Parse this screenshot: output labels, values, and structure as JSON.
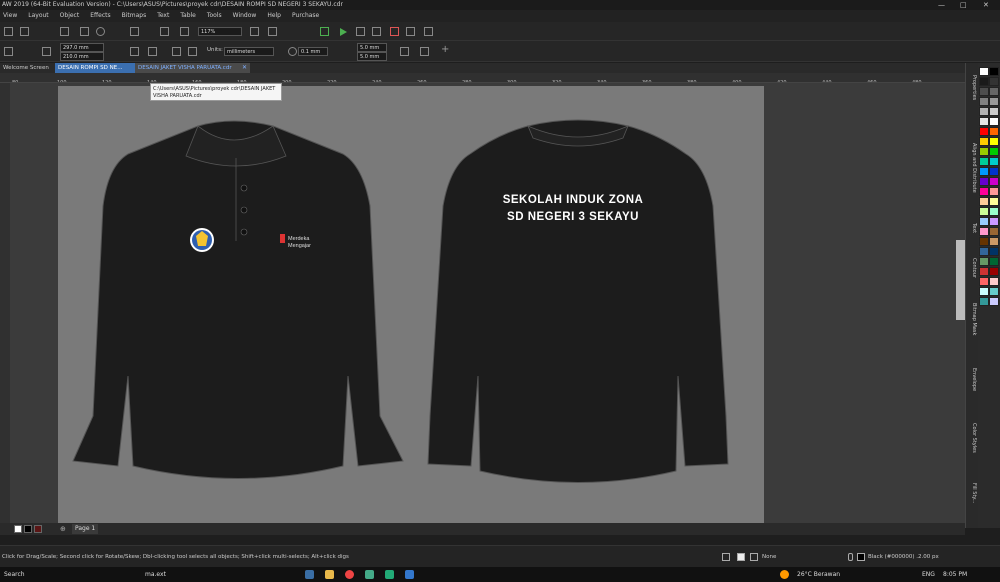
{
  "window": {
    "title": "AW 2019 (64-Bit Evaluation Version) - C:\\Users\\ASUS\\Pictures\\proyek cdr\\DESAIN ROMPI SD NEGERI 3 SEKAYU.cdr",
    "controls": [
      "—",
      "□",
      "✕"
    ]
  },
  "menu": [
    "View",
    "Layout",
    "Object",
    "Effects",
    "Bitmaps",
    "Text",
    "Table",
    "Tools",
    "Window",
    "Help",
    "Purchase"
  ],
  "toolbar": {
    "zoom": "117%",
    "width": "297.0 mm",
    "height": "210.0 mm",
    "units_label": "Units:",
    "units_value": "millimeters",
    "nudge": "0.1 mm",
    "dup_x": "5.0 mm",
    "dup_y": "5.0 mm"
  },
  "tabs": [
    "Welcome Screen",
    "DESAIN ROMPI SD NE...",
    "DESAIN JAKET VISHA PARUATA.cdr"
  ],
  "tooltip": "C:\\Users\\ASUS\\Pictures\\proyek cdr\\DESAIN JAKET VISHA PARUATA.cdr",
  "ruler_ticks": [
    "80",
    "100",
    "120",
    "140",
    "160",
    "180",
    "200",
    "220",
    "240",
    "260",
    "280",
    "300",
    "320",
    "340",
    "360",
    "380",
    "400",
    "420",
    "440",
    "460",
    "480"
  ],
  "design": {
    "back_line1": "SEKOLAH INDUK ZONA",
    "back_line2": "SD NEGERI 3 SEKAYU",
    "chest_logo_line1": "Merdeka",
    "chest_logo_line2": "Mengajar"
  },
  "dock": [
    "Properties",
    "Align and Distribute",
    "Text",
    "Contour",
    "Bitmap Mask",
    "Envelope",
    "Color Styles",
    "Fill Sty..."
  ],
  "palette_colors": [
    "#ffffff",
    "#000000",
    "#1a1a1a",
    "#333333",
    "#4d4d4d",
    "#666666",
    "#808080",
    "#999999",
    "#b3b3b3",
    "#cccccc",
    "#e6e6e6",
    "#ffffff",
    "#ff0000",
    "#ff6600",
    "#ffcc00",
    "#ffff00",
    "#99cc00",
    "#00cc00",
    "#00cc99",
    "#00cccc",
    "#0099ff",
    "#0033cc",
    "#6600cc",
    "#cc00cc",
    "#ff0099",
    "#ff9999",
    "#ffcc99",
    "#ffff99",
    "#ccff99",
    "#99ffcc",
    "#99ccff",
    "#cc99ff",
    "#ff99cc",
    "#996633",
    "#663300",
    "#cc9966",
    "#336699",
    "#003366",
    "#669966",
    "#006633",
    "#cc3333",
    "#990000",
    "#ff6666",
    "#ffcccc",
    "#ccffff",
    "#66cccc",
    "#339999",
    "#ccccff"
  ],
  "page_tab": "Page 1",
  "status": {
    "hint": "Click for Drag/Scale; Second click for Rotate/Skew; Dbl-clicking tool selects all objects; Shift+click multi-selects; Alt+click digs",
    "fill": "None",
    "outline": "Black (#000000)  .2.00 px"
  },
  "taskbar": {
    "search": "Search",
    "file": "ma.ext",
    "weather": "26°C  Berawan",
    "lang": "ENG",
    "time": "8:05 PM"
  }
}
